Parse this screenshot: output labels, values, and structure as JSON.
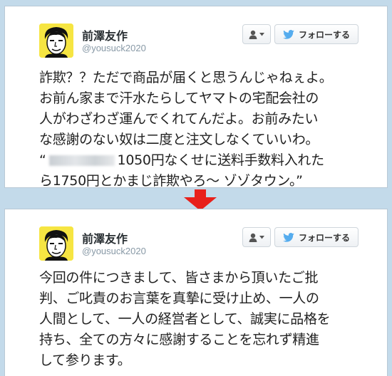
{
  "tweet_before": {
    "author_name": "前澤友作",
    "handle": "@yousuck2020",
    "follow_label": "フォローする",
    "text": "詐欺？？ただで商品が届くと思うんじゃねぇよ。\nお前ん家まで汗水たらしてヤマトの宅配会社の\n人がわざわざ運んでくれてんだよ。お前みたい\nな感謝のない奴は二度と注文しなくていいわ。",
    "quote_open": "“",
    "quote_rest": "1050円なくせに送料手数料入れた\nら1750円とかまじ詐欺やろ～ ゾゾタウン。”"
  },
  "tweet_after": {
    "author_name": "前澤友作",
    "handle": "@yousuck2020",
    "follow_label": "フォローする",
    "text": "今回の件につきまして、皆さまから頂いたご批\n判、ご叱責のお言葉を真摯に受け止め、一人の\n人間として、一人の経営者として、誠実に品格を\n持ち、全ての方々に感謝することを忘れず精進\nして参ります。"
  },
  "colors": {
    "background": "#c3daea",
    "arrow": "#e8201b",
    "twitter_blue": "#55acee",
    "avatar_bg": "#f6e542"
  },
  "icons": [
    "user-icon",
    "chevron-down-icon",
    "twitter-bird-icon",
    "down-arrow-icon"
  ]
}
